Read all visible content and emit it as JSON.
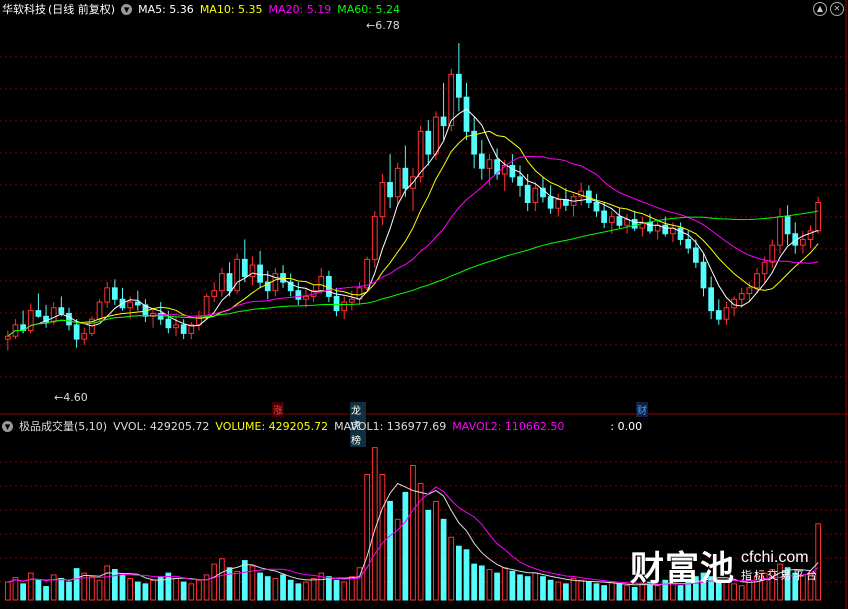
{
  "stock": {
    "title": "华软科技",
    "mode": "(日线 前复权)"
  },
  "price_legend": [
    {
      "label": "MA5: 5.36",
      "color": "#ffffff"
    },
    {
      "label": "MA10: 5.35",
      "color": "#ffff00"
    },
    {
      "label": "MA20: 5.19",
      "color": "#ff00ff"
    },
    {
      "label": "MA60: 5.24",
      "color": "#00ff00"
    }
  ],
  "price_annotations": {
    "high": "6.78",
    "low": "4.60"
  },
  "event_markers": [
    {
      "text": "涨",
      "color": "#ff4040"
    },
    {
      "text": "龙虎榜",
      "color": "#ffffff"
    },
    {
      "text": "财",
      "color": "#40a0ff"
    }
  ],
  "volume_legend": {
    "name": "极品成交量(5,10)",
    "items": [
      {
        "label": "VVOL: 429205.72",
        "color": "#dddddd"
      },
      {
        "label": "VOLUME: 429205.72",
        "color": "#ffff00"
      },
      {
        "label": "MAVOL1: 136977.69",
        "color": "#dddddd"
      },
      {
        "label": "MAVOL2: 110662.50",
        "color": "#ff00ff"
      },
      {
        "label": ": 0.00",
        "color": "#ffffff"
      }
    ]
  },
  "watermark": {
    "brand": "财富池",
    "url": "cfchi.com",
    "tagline": "指标交易平台"
  },
  "colors": {
    "up": "#ff3232",
    "down": "#54fcfc",
    "ma5": "#ffffff",
    "ma10": "#ffff00",
    "ma20": "#ff00ff",
    "ma60": "#00ff00",
    "grid": "#8b0000"
  },
  "chart_data": {
    "type": "candlestick",
    "y_range_price": [
      4.3,
      6.9
    ],
    "candles_ohlc": [
      [
        4.7,
        4.76,
        4.62,
        4.72
      ],
      [
        4.72,
        4.84,
        4.7,
        4.8
      ],
      [
        4.8,
        4.9,
        4.74,
        4.76
      ],
      [
        4.76,
        4.95,
        4.74,
        4.9
      ],
      [
        4.9,
        5.02,
        4.85,
        4.86
      ],
      [
        4.86,
        4.94,
        4.78,
        4.82
      ],
      [
        4.82,
        4.96,
        4.8,
        4.92
      ],
      [
        4.92,
        5.0,
        4.86,
        4.88
      ],
      [
        4.88,
        4.92,
        4.76,
        4.8
      ],
      [
        4.8,
        4.84,
        4.64,
        4.7
      ],
      [
        4.7,
        4.78,
        4.66,
        4.74
      ],
      [
        4.74,
        4.86,
        4.72,
        4.84
      ],
      [
        4.84,
        4.98,
        4.82,
        4.96
      ],
      [
        4.96,
        5.1,
        4.92,
        5.06
      ],
      [
        5.06,
        5.12,
        4.94,
        4.98
      ],
      [
        4.98,
        5.06,
        4.9,
        4.92
      ],
      [
        4.92,
        5.0,
        4.84,
        4.96
      ],
      [
        4.96,
        5.04,
        4.9,
        4.94
      ],
      [
        4.94,
        4.98,
        4.82,
        4.86
      ],
      [
        4.86,
        4.92,
        4.78,
        4.88
      ],
      [
        4.88,
        4.96,
        4.8,
        4.84
      ],
      [
        4.84,
        4.9,
        4.74,
        4.78
      ],
      [
        4.78,
        4.86,
        4.72,
        4.8
      ],
      [
        4.8,
        4.84,
        4.7,
        4.74
      ],
      [
        4.74,
        4.82,
        4.7,
        4.8
      ],
      [
        4.8,
        4.9,
        4.76,
        4.86
      ],
      [
        4.86,
        5.02,
        4.84,
        5.0
      ],
      [
        5.0,
        5.1,
        4.96,
        5.04
      ],
      [
        5.04,
        5.2,
        5.0,
        5.16
      ],
      [
        5.16,
        5.24,
        5.0,
        5.04
      ],
      [
        5.04,
        5.3,
        5.02,
        5.26
      ],
      [
        5.26,
        5.4,
        5.1,
        5.14
      ],
      [
        5.14,
        5.28,
        5.08,
        5.22
      ],
      [
        5.22,
        5.32,
        5.06,
        5.1
      ],
      [
        5.1,
        5.18,
        4.98,
        5.04
      ],
      [
        5.04,
        5.2,
        5.0,
        5.16
      ],
      [
        5.16,
        5.22,
        5.06,
        5.1
      ],
      [
        5.1,
        5.16,
        5.0,
        5.04
      ],
      [
        5.04,
        5.1,
        4.94,
        4.98
      ],
      [
        4.98,
        5.06,
        4.92,
        5.0
      ],
      [
        5.0,
        5.08,
        4.96,
        5.04
      ],
      [
        5.04,
        5.2,
        5.02,
        5.14
      ],
      [
        5.14,
        5.18,
        4.96,
        5.0
      ],
      [
        5.0,
        5.06,
        4.86,
        4.9
      ],
      [
        4.9,
        5.0,
        4.84,
        4.96
      ],
      [
        4.96,
        5.04,
        4.9,
        4.98
      ],
      [
        4.98,
        5.1,
        4.94,
        5.06
      ],
      [
        5.06,
        5.28,
        5.04,
        5.26
      ],
      [
        5.26,
        5.6,
        5.2,
        5.56
      ],
      [
        5.56,
        5.86,
        5.5,
        5.8
      ],
      [
        5.8,
        6.0,
        5.62,
        5.7
      ],
      [
        5.7,
        5.94,
        5.64,
        5.9
      ],
      [
        5.9,
        6.06,
        5.7,
        5.76
      ],
      [
        5.76,
        5.9,
        5.6,
        5.84
      ],
      [
        5.84,
        6.2,
        5.8,
        6.16
      ],
      [
        6.16,
        6.24,
        5.92,
        6.0
      ],
      [
        6.0,
        6.3,
        5.96,
        6.26
      ],
      [
        6.26,
        6.5,
        6.1,
        6.2
      ],
      [
        6.2,
        6.6,
        6.16,
        6.56
      ],
      [
        6.56,
        6.78,
        6.3,
        6.4
      ],
      [
        6.4,
        6.5,
        6.1,
        6.16
      ],
      [
        6.16,
        6.26,
        5.9,
        6.0
      ],
      [
        6.0,
        6.1,
        5.82,
        5.9
      ],
      [
        5.9,
        6.0,
        5.78,
        5.96
      ],
      [
        5.96,
        6.04,
        5.82,
        5.86
      ],
      [
        5.86,
        5.96,
        5.74,
        5.92
      ],
      [
        5.92,
        6.0,
        5.8,
        5.84
      ],
      [
        5.84,
        5.92,
        5.7,
        5.78
      ],
      [
        5.78,
        5.86,
        5.6,
        5.66
      ],
      [
        5.66,
        5.8,
        5.6,
        5.76
      ],
      [
        5.76,
        5.84,
        5.66,
        5.7
      ],
      [
        5.7,
        5.78,
        5.58,
        5.62
      ],
      [
        5.62,
        5.72,
        5.56,
        5.68
      ],
      [
        5.68,
        5.76,
        5.6,
        5.64
      ],
      [
        5.64,
        5.72,
        5.56,
        5.7
      ],
      [
        5.7,
        5.8,
        5.64,
        5.74
      ],
      [
        5.74,
        5.78,
        5.62,
        5.66
      ],
      [
        5.66,
        5.72,
        5.56,
        5.6
      ],
      [
        5.6,
        5.66,
        5.48,
        5.52
      ],
      [
        5.52,
        5.6,
        5.44,
        5.56
      ],
      [
        5.56,
        5.62,
        5.48,
        5.5
      ],
      [
        5.5,
        5.58,
        5.44,
        5.54
      ],
      [
        5.54,
        5.6,
        5.46,
        5.48
      ],
      [
        5.48,
        5.56,
        5.42,
        5.52
      ],
      [
        5.52,
        5.58,
        5.44,
        5.46
      ],
      [
        5.46,
        5.54,
        5.4,
        5.5
      ],
      [
        5.5,
        5.56,
        5.42,
        5.44
      ],
      [
        5.44,
        5.52,
        5.38,
        5.48
      ],
      [
        5.48,
        5.52,
        5.36,
        5.4
      ],
      [
        5.4,
        5.46,
        5.3,
        5.34
      ],
      [
        5.34,
        5.4,
        5.2,
        5.24
      ],
      [
        5.24,
        5.3,
        5.0,
        5.06
      ],
      [
        5.06,
        5.14,
        4.84,
        4.9
      ],
      [
        4.9,
        4.98,
        4.8,
        4.84
      ],
      [
        4.84,
        4.96,
        4.8,
        4.92
      ],
      [
        4.92,
        5.0,
        4.86,
        4.98
      ],
      [
        4.98,
        5.06,
        4.92,
        5.02
      ],
      [
        5.02,
        5.1,
        4.96,
        5.06
      ],
      [
        5.06,
        5.2,
        5.02,
        5.16
      ],
      [
        5.16,
        5.28,
        5.1,
        5.24
      ],
      [
        5.24,
        5.4,
        5.2,
        5.36
      ],
      [
        5.36,
        5.62,
        5.3,
        5.56
      ],
      [
        5.56,
        5.64,
        5.36,
        5.44
      ],
      [
        5.44,
        5.52,
        5.3,
        5.36
      ],
      [
        5.36,
        5.46,
        5.3,
        5.4
      ],
      [
        5.4,
        5.5,
        5.34,
        5.46
      ],
      [
        5.46,
        5.7,
        5.44,
        5.66
      ]
    ],
    "volumes": [
      20,
      25,
      18,
      30,
      22,
      15,
      28,
      24,
      20,
      35,
      30,
      26,
      22,
      38,
      34,
      28,
      24,
      20,
      18,
      22,
      26,
      30,
      24,
      20,
      18,
      22,
      28,
      40,
      46,
      36,
      32,
      44,
      38,
      30,
      26,
      24,
      28,
      22,
      18,
      20,
      24,
      30,
      26,
      22,
      20,
      26,
      36,
      140,
      170,
      140,
      110,
      90,
      120,
      150,
      130,
      100,
      110,
      90,
      70,
      60,
      56,
      40,
      38,
      34,
      30,
      36,
      32,
      28,
      26,
      30,
      26,
      22,
      20,
      18,
      24,
      22,
      20,
      18,
      16,
      20,
      18,
      16,
      14,
      18,
      20,
      16,
      22,
      18,
      16,
      20,
      26,
      30,
      26,
      22,
      20,
      18,
      16,
      22,
      26,
      30,
      34,
      40,
      36,
      30,
      28,
      30,
      85
    ]
  }
}
